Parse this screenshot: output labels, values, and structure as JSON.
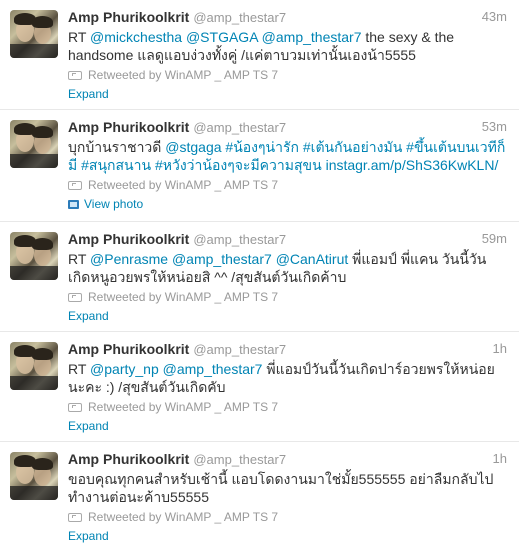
{
  "tweets": [
    {
      "fullname": "Amp Phurikoolkrit",
      "screen_name": "@amp_thestar7",
      "time": "43m",
      "text_parts": [
        {
          "t": "RT ",
          "link": false
        },
        {
          "t": "@mickchestha",
          "link": true
        },
        {
          "t": " ",
          "link": false
        },
        {
          "t": "@STGAGA",
          "link": true
        },
        {
          "t": " ",
          "link": false
        },
        {
          "t": "@amp_thestar7",
          "link": true
        },
        {
          "t": " the sexy & the handsome แลดูแอบง่วงทั้งคู่ /แค่ตาบวมเท่านั้นเองน้า5555",
          "link": false
        }
      ],
      "retweeted_by": "Retweeted by WinAMP _ AMP TS 7",
      "action": "Expand",
      "action_icon": ""
    },
    {
      "fullname": "Amp Phurikoolkrit",
      "screen_name": "@amp_thestar7",
      "time": "53m",
      "text_parts": [
        {
          "t": "บุกบ้านราชาวดี ",
          "link": false
        },
        {
          "t": "@stgaga",
          "link": true
        },
        {
          "t": " ",
          "link": false
        },
        {
          "t": "#น้องๆน่ารัก",
          "link": true
        },
        {
          "t": " ",
          "link": false
        },
        {
          "t": "#เต้นกันอย่างมัน",
          "link": true
        },
        {
          "t": " ",
          "link": false
        },
        {
          "t": "#ขึ้นเต้นบนเวทีก็มี",
          "link": true
        },
        {
          "t": " ",
          "link": false
        },
        {
          "t": "#สนุกสนาน",
          "link": true
        },
        {
          "t": " ",
          "link": false
        },
        {
          "t": "#หวังว่าน้องๆจะมีความสุขน",
          "link": true
        },
        {
          "t": " ",
          "link": false
        },
        {
          "t": "instagr.am/p/ShS36KwKLN/",
          "link": true
        }
      ],
      "retweeted_by": "Retweeted by WinAMP _ AMP TS 7",
      "action": "View photo",
      "action_icon": "photo-icon"
    },
    {
      "fullname": "Amp Phurikoolkrit",
      "screen_name": "@amp_thestar7",
      "time": "59m",
      "text_parts": [
        {
          "t": "RT ",
          "link": false
        },
        {
          "t": "@Penrasme",
          "link": true
        },
        {
          "t": " ",
          "link": false
        },
        {
          "t": "@amp_thestar7",
          "link": true
        },
        {
          "t": " ",
          "link": false
        },
        {
          "t": "@CanAtirut",
          "link": true
        },
        {
          "t": " พี่แอมป์ พี่แคน วันนี้วันเกิดหนูอวยพรให้หน่อยสิ ^^ /สุขสันต์วันเกิดค้าบ",
          "link": false
        }
      ],
      "retweeted_by": "Retweeted by WinAMP _ AMP TS 7",
      "action": "Expand",
      "action_icon": ""
    },
    {
      "fullname": "Amp Phurikoolkrit",
      "screen_name": "@amp_thestar7",
      "time": "1h",
      "text_parts": [
        {
          "t": "RT ",
          "link": false
        },
        {
          "t": "@party_np",
          "link": true
        },
        {
          "t": " ",
          "link": false
        },
        {
          "t": "@amp_thestar7",
          "link": true
        },
        {
          "t": " พี่แอมป์วันนี้วันเกิดปาร์อวยพรให้หน่อยนะคะ :) /สุขสันต์วันเกิดคับ",
          "link": false
        }
      ],
      "retweeted_by": "Retweeted by WinAMP _ AMP TS 7",
      "action": "Expand",
      "action_icon": ""
    },
    {
      "fullname": "Amp Phurikoolkrit",
      "screen_name": "@amp_thestar7",
      "time": "1h",
      "text_parts": [
        {
          "t": "ขอบคุณทุกคนสำหรับเช้านี้ แอบโดดงานมาใช่มั้ย555555 อย่าลืมกลับไปทำงานต่อนะค้าบ55555",
          "link": false
        }
      ],
      "retweeted_by": "Retweeted by WinAMP _ AMP TS 7",
      "action": "Expand",
      "action_icon": ""
    }
  ]
}
